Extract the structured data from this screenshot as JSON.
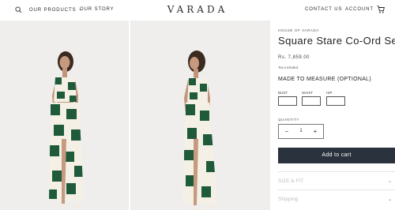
{
  "header": {
    "nav_left": [
      {
        "label": "OUR PRODUCTS"
      },
      {
        "label": "OUR STORY"
      }
    ],
    "logo": "VARADA",
    "nav_right": [
      {
        "label": "CONTACT US"
      },
      {
        "label": "ACCOUNT"
      }
    ],
    "icons": {
      "search": "search-icon",
      "cart": "cart-icon",
      "dropdown": "chevron-down-icon"
    }
  },
  "gallery": {
    "images": [
      {
        "name": "model-front-view"
      },
      {
        "name": "model-side-view"
      }
    ],
    "colors": {
      "background": "#efeeed",
      "print_green": "#1f5a3a",
      "print_cream": "#f4f0e6"
    }
  },
  "product": {
    "brand": "HOUSE OF VARADA",
    "title": "Square Stare Co-Ord Set",
    "price": "Rs. 7,859.00",
    "tax_note": "Tax included.",
    "made_to_measure": "MADE TO MEASURE (OPTIONAL)",
    "measurements": [
      {
        "label": "BUST",
        "value": ""
      },
      {
        "label": "WAIST",
        "value": ""
      },
      {
        "label": "HIP",
        "value": ""
      }
    ],
    "quantity_label": "QUANTITY",
    "quantity": "1",
    "add_to_cart": "Add to cart",
    "accordions": [
      {
        "label": "SIZE & FIT"
      },
      {
        "label": "Shipping"
      }
    ]
  },
  "colors": {
    "button_bg": "#2a323d",
    "button_text": "#ffffff"
  }
}
